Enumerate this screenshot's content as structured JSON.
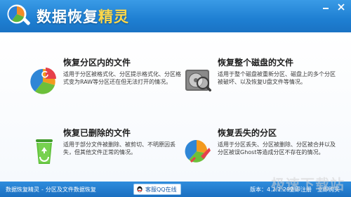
{
  "window": {
    "title_main": "数据恢复",
    "title_accent": "精灵",
    "controls": [
      "minimize",
      "close"
    ]
  },
  "cards": [
    {
      "title": "恢复分区内的文件",
      "desc": "适用于分区被格式化、分区提示格式化、分区格式变为RAW等分区还在但无法打开的情况。",
      "icon": "pie-chart-icon"
    },
    {
      "title": "恢复整个磁盘的文件",
      "desc": "适用于整个磁盘被重新分区、磁盘上的多个分区被破坏、以及恢复U盘文件等情况。",
      "icon": "hard-disk-icon"
    },
    {
      "title": "恢复已删除的文件",
      "desc": "适用于部分文件被删除、被剪切、不明原因丢失，但其他文件正常的情况。",
      "icon": "recycle-bin-icon"
    },
    {
      "title": "恢复丢失的分区",
      "desc": "适用于分区丢失、分区被删除、分区被合并以及分区被误Ghost等造成分区不存在的情况。",
      "icon": "partition-restore-icon"
    }
  ],
  "statusbar": {
    "app_name": "数据恢复精灵",
    "separator": "-",
    "subtitle": "分区及文件数据恢复",
    "qq_label": "客服QQ在线",
    "version": "版本：4.2.1.297",
    "links": [
      "立即注册",
      "立即购买"
    ]
  },
  "watermark": "极速下载站",
  "colors": {
    "titlebar": "#1e7fd2",
    "title_accent": "#ffd84a",
    "statusbar": "#1b6fc0"
  }
}
